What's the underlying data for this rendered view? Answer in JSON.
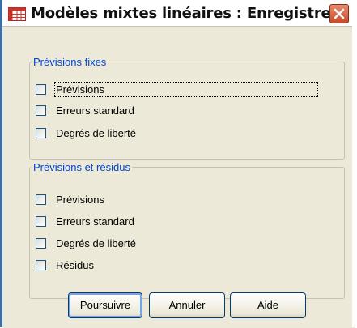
{
  "window": {
    "title": "Modèles mixtes linéaires : Enregistrer",
    "icon": "table-grid-icon",
    "close_icon": "close-icon"
  },
  "fixed_predictions": {
    "legend": "Prévisions fixes",
    "items": [
      {
        "label": "Prévisions",
        "checked": false,
        "focused": true
      },
      {
        "label": "Erreurs standard",
        "checked": false,
        "focused": false
      },
      {
        "label": "Degrés de liberté",
        "checked": false,
        "focused": false
      }
    ]
  },
  "predictions_residuals": {
    "legend": "Prévisions et résidus",
    "items": [
      {
        "label": "Prévisions",
        "checked": false
      },
      {
        "label": "Erreurs standard",
        "checked": false
      },
      {
        "label": "Degrés de liberté",
        "checked": false
      },
      {
        "label": "Résidus",
        "checked": false
      }
    ]
  },
  "buttons": {
    "continue": "Poursuivre",
    "cancel": "Annuler",
    "help": "Aide"
  },
  "colors": {
    "window_border": "#3a6ea5",
    "dialog_background": "#ece9d8",
    "legend_text": "#0046d5",
    "close_button": "#c64c2a"
  }
}
